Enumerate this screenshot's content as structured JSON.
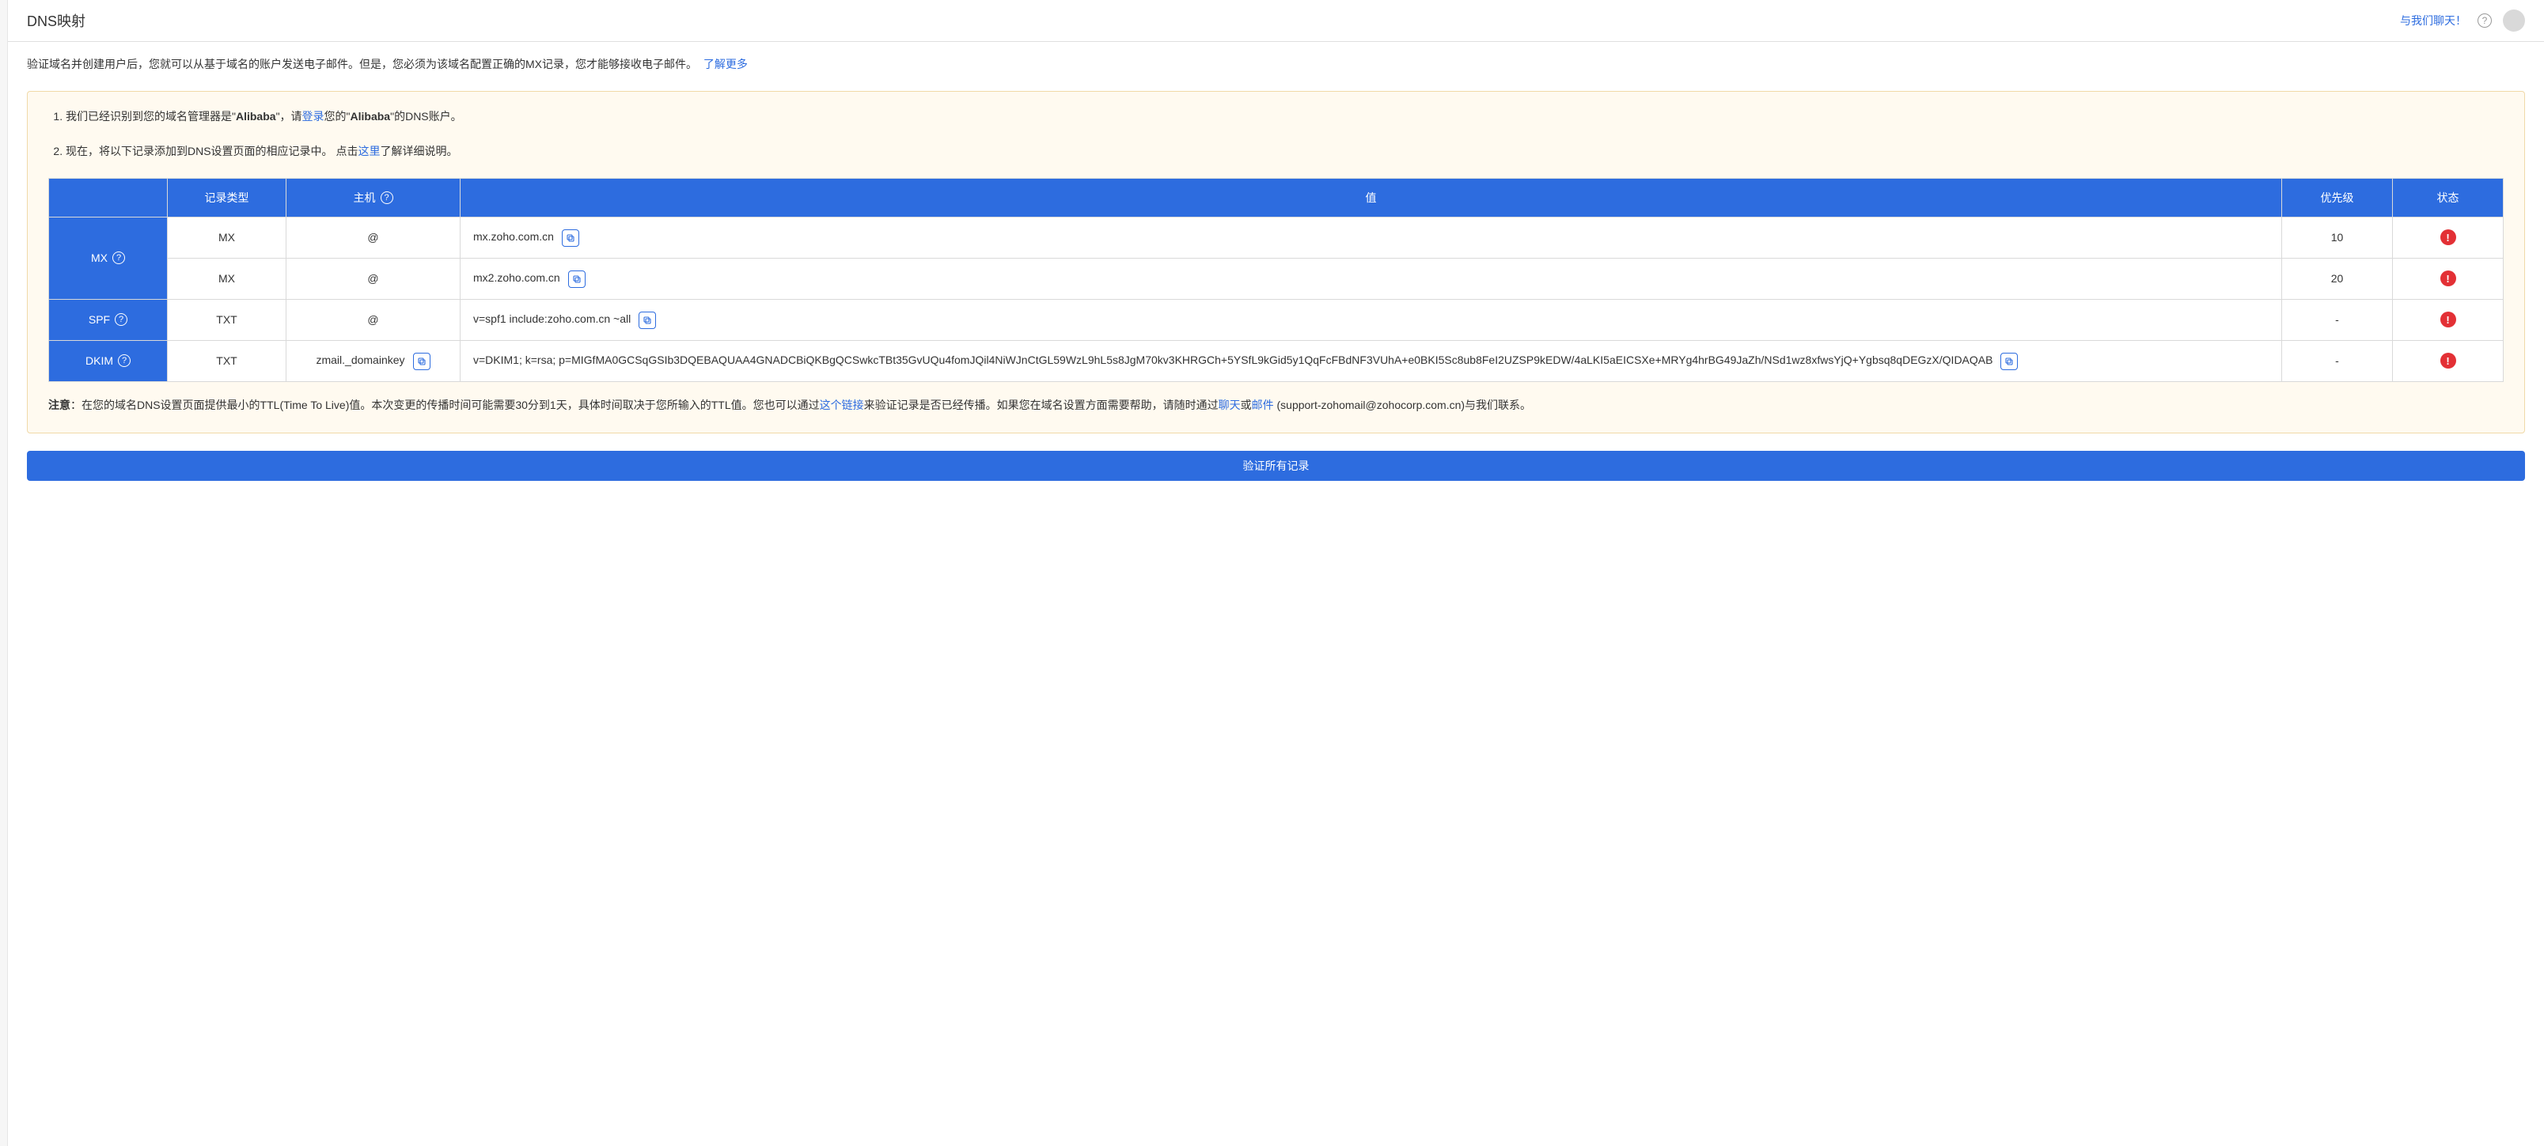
{
  "header": {
    "title": "DNS映射",
    "chat_link": "与我们聊天！"
  },
  "intro": {
    "text": "验证域名并创建用户后，您就可以从基于域名的账户发送电子邮件。但是，您必须为该域名配置正确的MX记录，您才能够接收电子邮件。",
    "learn_more": "了解更多"
  },
  "tips": {
    "item1_pre": "我们已经识别到您的域名管理器是\"",
    "item1_provider": "Alibaba",
    "item1_mid": "\"，请",
    "item1_login": "登录",
    "item1_mid2": "您的\"",
    "item1_provider2": "Alibaba",
    "item1_post": "\"的DNS账户。",
    "item2_pre": "现在，将以下记录添加到DNS设置页面的相应记录中。 点击",
    "item2_here": "这里",
    "item2_post": "了解详细说明。"
  },
  "table": {
    "headers": {
      "record_type": "记录类型",
      "host": "主机",
      "value": "值",
      "priority": "优先级",
      "status": "状态"
    },
    "group_labels": {
      "mx": "MX",
      "spf": "SPF",
      "dkim": "DKIM"
    },
    "rows": [
      {
        "type": "MX",
        "host": "@",
        "value": "mx.zoho.com.cn",
        "priority": "10",
        "status": "error"
      },
      {
        "type": "MX",
        "host": "@",
        "value": "mx2.zoho.com.cn",
        "priority": "20",
        "status": "error"
      },
      {
        "type": "TXT",
        "host": "@",
        "value": "v=spf1 include:zoho.com.cn ~all",
        "priority": "-",
        "status": "error"
      },
      {
        "type": "TXT",
        "host": "zmail._domainkey",
        "value": "v=DKIM1; k=rsa; p=MIGfMA0GCSqGSIb3DQEBAQUAA4GNADCBiQKBgQCSwkcTBt35GvUQu4fomJQil4NiWJnCtGL59WzL9hL5s8JgM70kv3KHRGCh+5YSfL9kGid5y1QqFcFBdNF3VUhA+e0BKI5Sc8ub8FeI2UZSP9kEDW/4aLKI5aEICSXe+MRYg4hrBG49JaZh/NSd1wz8xfwsYjQ+Ygbsq8qDEGzX/QIDAQAB",
        "priority": "-",
        "status": "error"
      }
    ]
  },
  "note": {
    "label": "注意",
    "text1": "：在您的域名DNS设置页面提供最小的TTL(Time To Live)值。本次变更的传播时间可能需要30分到1天，具体时间取决于您所输入的TTL值。您也可以通过",
    "link1": "这个链接",
    "text2": "来验证记录是否已经传播。如果您在域名设置方面需要帮助，请随时通过",
    "chat": "聊天",
    "text3": "或",
    "email": "邮件",
    "text4": " (support-zohomail@zohocorp.com.cn)与我们联系。"
  },
  "verify_button": "验证所有记录"
}
